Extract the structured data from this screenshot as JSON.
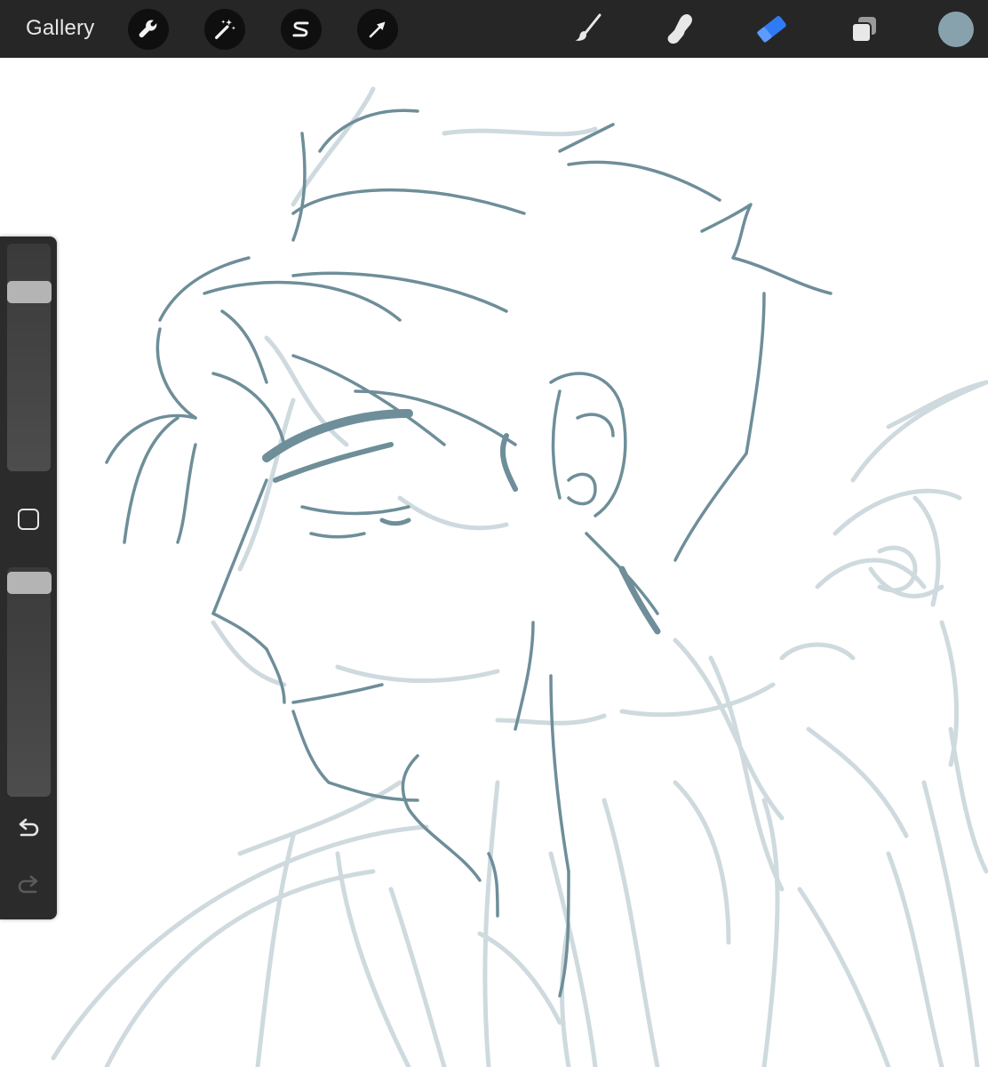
{
  "toolbar": {
    "gallery_label": "Gallery",
    "actions_icon": "wrench-icon",
    "adjustments_icon": "magic-wand-icon",
    "selection_icon": "selection-s-icon",
    "transform_icon": "arrow-cursor-icon",
    "brush_icon": "paintbrush-icon",
    "smudge_icon": "smudge-finger-icon",
    "eraser_icon": "eraser-icon",
    "layers_icon": "layers-icon",
    "active_tool": "eraser",
    "current_color": "#87a2ad"
  },
  "colors": {
    "toolbar_bg": "#262626",
    "active_tool_accent": "#2f7bf5",
    "sketch_dark": "#6e8e99",
    "sketch_light": "#c9d6db"
  },
  "sidebar": {
    "brush_size_level": 0.82,
    "opacity_level": 0.98,
    "modify_icon": "square-modify-icon",
    "undo_icon": "undo-arrow-icon",
    "redo_icon": "redo-arrow-icon",
    "redo_enabled": false
  }
}
